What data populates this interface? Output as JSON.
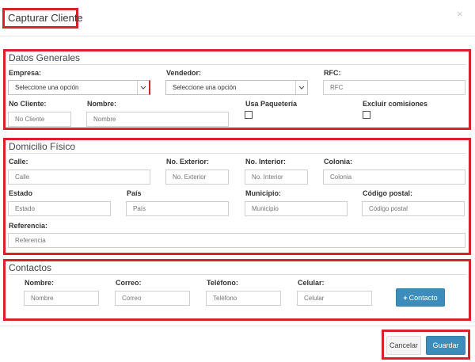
{
  "modal": {
    "title": "Capturar Cliente",
    "close_glyph": "×"
  },
  "datos_generales": {
    "legend": "Datos Generales",
    "empresa": {
      "label": "Empresa:",
      "value": "Seleccione una opción"
    },
    "vendedor": {
      "label": "Vendedor:",
      "value": "Seleccione una opción"
    },
    "rfc": {
      "label": "RFC:",
      "placeholder": "RFC"
    },
    "no_cliente": {
      "label": "No Cliente:",
      "placeholder": "No Cliente"
    },
    "nombre": {
      "label": "Nombre:",
      "placeholder": "Nombre"
    },
    "usa_paqueteria": {
      "label": "Usa Paquetería",
      "checked": false
    },
    "excluir_comisiones": {
      "label": "Excluir comisiones",
      "checked": false
    }
  },
  "domicilio": {
    "legend": "Domicilio Físico",
    "calle": {
      "label": "Calle:",
      "placeholder": "Calle"
    },
    "no_exterior": {
      "label": "No. Exterior:",
      "placeholder": "No. Exterior"
    },
    "no_interior": {
      "label": "No. Interior:",
      "placeholder": "No. Interior"
    },
    "colonia": {
      "label": "Colonia:",
      "placeholder": "Colonia"
    },
    "estado": {
      "label": "Estado",
      "placeholder": "Estado"
    },
    "pais": {
      "label": "País",
      "placeholder": "País"
    },
    "municipio": {
      "label": "Municipio:",
      "placeholder": "Municipio"
    },
    "codigo_postal": {
      "label": "Código postal:",
      "placeholder": "Código postal"
    },
    "referencia": {
      "label": "Referencia:",
      "placeholder": "Referencia"
    }
  },
  "contactos": {
    "legend": "Contactos",
    "nombre": {
      "label": "Nombre:",
      "placeholder": "Nombre"
    },
    "correo": {
      "label": "Correo:",
      "placeholder": "Correo"
    },
    "telefono": {
      "label": "Teléfono:",
      "placeholder": "Teléfono"
    },
    "celular": {
      "label": "Celular:",
      "placeholder": "Celular"
    },
    "add_button": {
      "icon_glyph": "+",
      "label": "Contacto"
    }
  },
  "footer": {
    "cancel_label": "Cancelar",
    "save_label": "Guardar"
  },
  "colors": {
    "highlight": "#d9202b",
    "primary": "#3c8dbc"
  }
}
